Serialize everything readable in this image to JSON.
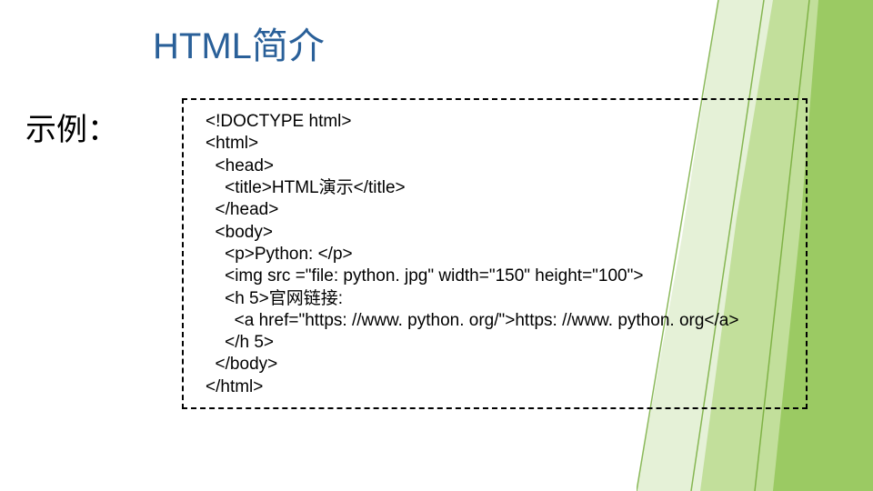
{
  "slide": {
    "title": "HTML简介",
    "example_label": "示例：",
    "code": "<!DOCTYPE html>\n<html>\n  <head>\n    <title>HTML演示</title>\n  </head>\n  <body>\n    <p>Python: </p>\n    <img src =\"file: python. jpg\" width=\"150\" height=\"100\">\n    <h 5>官网链接:\n      <a href=\"https: //www. python. org/\">https: //www. python. org</a>\n    </h 5>\n  </body>\n</html>"
  }
}
